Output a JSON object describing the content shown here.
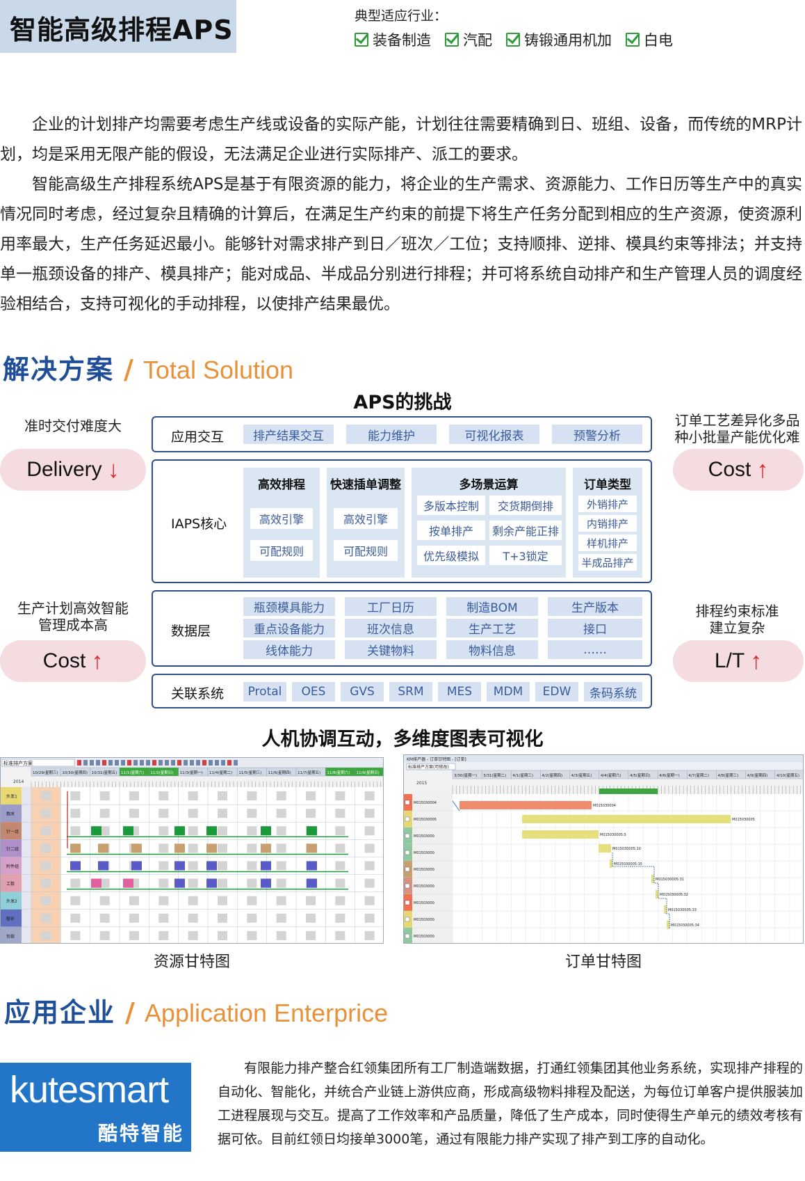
{
  "header": {
    "title": "智能高级排程APS",
    "industry_label": "典型适应行业：",
    "industries": [
      "装备制造",
      "汽配",
      "铸锻通用机加",
      "白电"
    ]
  },
  "intro": {
    "p1": "企业的计划排产均需要考虑生产线或设备的实际产能，计划往往需要精确到日、班组、设备，而传统的MRP计划，均是采用无限产能的假设，无法满足企业进行实际排产、派工的要求。",
    "p2": "智能高级生产排程系统APS是基于有限资源的能力，将企业的生产需求、资源能力、工作日历等生产中的真实情况同时考虑，经过复杂且精确的计算后，在满足生产约束的前提下将生产任务分配到相应的生产资源，使资源利用率最大，生产任务延迟最小。能够针对需求排产到日／班次／工位；支持顺排、逆排、模具约束等排法；并支持单一瓶颈设备的排产、模具排产；能对成品、半成品分别进行排程；并可将系统自动排产和生产管理人员的调度经验相结合，支持可视化的手动排程，以使排产结果最优。"
  },
  "solution": {
    "cn": "解决方案",
    "slash": "/",
    "en": "Total Solution"
  },
  "aps": {
    "title": "APS的挑战",
    "left_top_label": "准时交付难度大",
    "left_top_pill": "Delivery",
    "left_bottom_label_1": "生产计划高效智能",
    "left_bottom_label_2": "管理成本高",
    "left_bottom_pill": "Cost",
    "right_top_label_1": "订单工艺差异化多品",
    "right_top_label_2": "种小批量产能优化难",
    "right_top_pill": "Cost",
    "right_bottom_label_1": "排程约束标准",
    "right_bottom_label_2": "建立复杂",
    "right_bottom_pill": "L/T",
    "arrow_up": "↑",
    "arrow_down": "↓",
    "layer1": {
      "label": "应用交互",
      "items": [
        "排产结果交互",
        "能力维护",
        "可视化报表",
        "预警分析"
      ]
    },
    "layer2": {
      "label": "IAPS核心",
      "col1": {
        "head": "高效排程",
        "items": [
          "高效引擎",
          "可配规则"
        ]
      },
      "col2": {
        "head": "快速插单调整",
        "items": [
          "高效引擎",
          "可配规则"
        ]
      },
      "col3": {
        "head": "多场景运算",
        "items": [
          "多版本控制",
          "交货期倒排",
          "按单排产",
          "剩余产能正排",
          "优先级模拟",
          "T+3锁定"
        ]
      },
      "col4": {
        "head": "订单类型",
        "items": [
          "外销排产",
          "内销排产",
          "样机排产",
          "半成品排产"
        ]
      }
    },
    "layer3": {
      "label": "数据层",
      "items": [
        "瓶颈模具能力",
        "工厂日历",
        "制造BOM",
        "生产版本",
        "重点设备能力",
        "班次信息",
        "生产工艺",
        "接口",
        "线体能力",
        "关键物料",
        "物料信息",
        "……"
      ]
    },
    "layer4": {
      "label": "关联系统",
      "items": [
        "Protal",
        "OES",
        "GVS",
        "SRM",
        "MES",
        "MDM",
        "EDW",
        "条码系统"
      ]
    }
  },
  "gantt": {
    "title": "人机协调互动，多维度图表可视化",
    "left_caption": "资源甘特图",
    "right_caption": "订单甘特图",
    "left_combo": "标准排产方案",
    "right_window_title": "KM排产器 - 订单甘特图 - [订单]",
    "right_combo": "标准排产方案(可修改)",
    "left_year": "2014",
    "right_year": "2015",
    "left_dates": [
      "10/29(星期三)",
      "10/30(星期四)",
      "10/31(星期五)",
      "11/1(星期六)",
      "11/2(星期日)",
      "11/3(星期一)",
      "11/4(星期二)",
      "11/5(星期三)",
      "11/6(星期四)",
      "11/7(星期五)",
      "11/8(星期六)",
      "11/9(星期日)"
    ],
    "right_dates": [
      "3/30(星期一)",
      "3/31(星期二)",
      "4/1(星期三)",
      "4/2(星期四)",
      "4/3(星期五)",
      "4/4(星期六)",
      "4/5(星期日)",
      "4/6(星期一)",
      "4/7(星期二)",
      "4/8(星期三)",
      "4/9(星期四)",
      "4/10(星期五)"
    ],
    "left_rows": [
      "外发1",
      "数床",
      "针一组",
      "针二组",
      "附件组",
      "工数",
      "外发2",
      "整补",
      "包装"
    ],
    "right_rows": [
      "M015030004",
      "M015030005",
      "M01503000",
      "M01503000",
      "M01503000",
      "M01503000",
      "M01503000",
      "M01503000",
      "M01503000"
    ],
    "right_bar_labels": [
      "M015030004",
      "M015030005",
      "M015030005:5",
      "M015030005:10",
      "M015030005:15",
      "M015030005:31",
      "M015030005:32",
      "M015030005:33",
      "M015030005:34"
    ],
    "colors": {
      "green": "#1a9a3a",
      "blue": "#5a5ac8",
      "pink": "#e060a0",
      "tan": "#c8a070",
      "yellow": "#e5df7c",
      "salmon": "#f08a6c",
      "header_green": "#3aa83a"
    }
  },
  "enterprise": {
    "cn": "应用企业",
    "slash": "/",
    "en": "Application Enterprice",
    "logo_en": "kutesmart",
    "logo_cn": "酷特智能",
    "text": "有限能力排产整合红领集团所有工厂制造端数据，打通红领集团其他业务系统，实现排产排程的自动化、智能化，并统合产业链上游供应商，形成高级物料排程及配送，为每位订单客户提供服装加工进程展现与交互。提高了工作效率和产品质量，降低了生产成本，同时使得生产单元的绩效考核有据可依。目前红领日均接单3000笔，通过有限能力排产实现了排产到工序的自动化。"
  }
}
